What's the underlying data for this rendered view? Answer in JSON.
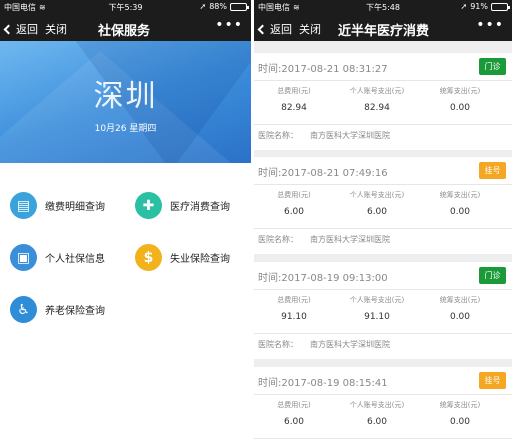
{
  "left": {
    "status": {
      "carrier": "中国电信",
      "time": "下午5:39",
      "battery": "88%",
      "battery_level": 0.88
    },
    "nav": {
      "back": "返回",
      "close": "关闭",
      "title": "社保服务",
      "more": "•••"
    },
    "banner": {
      "city": "深圳",
      "date": "10月26  星期四"
    },
    "menu": [
      {
        "label": "缴费明细查询",
        "color": "#3aa3dc",
        "glyph": "▤"
      },
      {
        "label": "医疗消费查询",
        "color": "#2bbfa3",
        "glyph": "✚"
      },
      {
        "label": "个人社保信息",
        "color": "#3b8fd9",
        "glyph": "▣"
      },
      {
        "label": "失业保险查询",
        "color": "#f2b21b",
        "glyph": "$"
      },
      {
        "label": "养老保险查询",
        "color": "#2f8dd8",
        "glyph": "♿"
      }
    ]
  },
  "right": {
    "status": {
      "carrier": "中国电信",
      "time": "下午5:48",
      "battery": "91%",
      "battery_level": 0.91
    },
    "nav": {
      "back": "返回",
      "close": "关闭",
      "title": "近半年医疗消费",
      "more": "•••"
    },
    "labels": {
      "total": "总费用(元)",
      "personal": "个人账号支出(元)",
      "pooled": "统筹支出(元)",
      "hospital": "医院名称："
    },
    "records": [
      {
        "time": "时间:2017-08-21 08:31:27",
        "badge": "门诊",
        "badge_color": "#1b9a3a",
        "total": "82.94",
        "personal": "82.94",
        "pooled": "0.00",
        "hospital": "南方医科大学深圳医院"
      },
      {
        "time": "时间:2017-08-21 07:49:16",
        "badge": "挂号",
        "badge_color": "#f5a623",
        "total": "6.00",
        "personal": "6.00",
        "pooled": "0.00",
        "hospital": "南方医科大学深圳医院"
      },
      {
        "time": "时间:2017-08-19 09:13:00",
        "badge": "门诊",
        "badge_color": "#1b9a3a",
        "total": "91.10",
        "personal": "91.10",
        "pooled": "0.00",
        "hospital": "南方医科大学深圳医院"
      },
      {
        "time": "时间:2017-08-19 08:15:41",
        "badge": "挂号",
        "badge_color": "#f5a623",
        "total": "6.00",
        "personal": "6.00",
        "pooled": "0.00",
        "hospital": ""
      }
    ]
  }
}
